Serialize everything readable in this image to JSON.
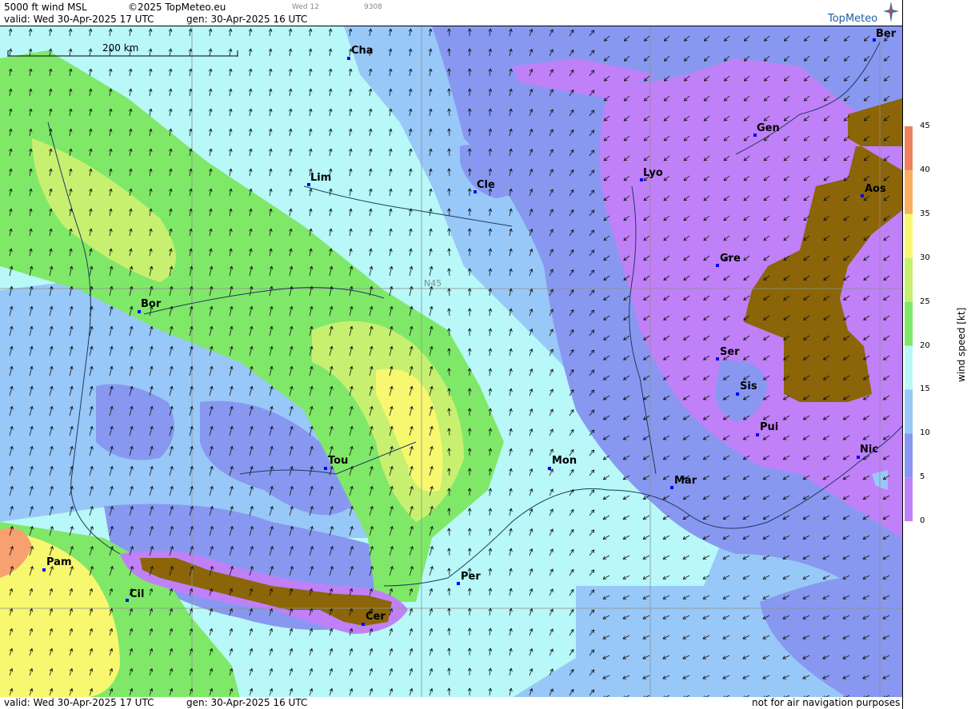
{
  "header": {
    "product": "5000 ft wind MSL",
    "copyright": "©2025 TopMeteo.eu",
    "day_code": "Wed 12",
    "code": "9308",
    "valid": "valid:  Wed  30-Apr-2025  17 UTC",
    "gen": "gen:  30-Apr-2025  16 UTC"
  },
  "logo": {
    "text": "TopMeteo"
  },
  "footer": {
    "valid": "valid:  Wed  30-Apr-2025  17 UTC",
    "gen": "gen:  30-Apr-2025  16 UTC",
    "disclaimer": "not for air navigation purposes"
  },
  "map": {
    "scale_label": "200 km",
    "grid_label": "N45",
    "cities": [
      {
        "id": "cha",
        "label": "Cha"
      },
      {
        "id": "ber",
        "label": "Ber"
      },
      {
        "id": "gen",
        "label": "Gen"
      },
      {
        "id": "lim",
        "label": "Lim"
      },
      {
        "id": "cle",
        "label": "Cle"
      },
      {
        "id": "lyo",
        "label": "Lyo"
      },
      {
        "id": "aos",
        "label": "Aos"
      },
      {
        "id": "gre",
        "label": "Gre"
      },
      {
        "id": "bor",
        "label": "Bor"
      },
      {
        "id": "ser",
        "label": "Ser"
      },
      {
        "id": "sis",
        "label": "Sis"
      },
      {
        "id": "pui",
        "label": "Pui"
      },
      {
        "id": "tou",
        "label": "Tou"
      },
      {
        "id": "mon",
        "label": "Mon"
      },
      {
        "id": "mar",
        "label": "Mar"
      },
      {
        "id": "nic",
        "label": "Nic"
      },
      {
        "id": "pam",
        "label": "Pam"
      },
      {
        "id": "cil",
        "label": "Cil"
      },
      {
        "id": "per",
        "label": "Per"
      },
      {
        "id": "cer",
        "label": "Cer"
      }
    ]
  },
  "legend": {
    "title": "wind  speed  [kt]",
    "ticks": [
      "45",
      "40",
      "35",
      "30",
      "25",
      "20",
      "15",
      "10",
      "5",
      "0"
    ],
    "colors": [
      "#f08060",
      "#f8b060",
      "#f8f870",
      "#c8f070",
      "#80e868",
      "#b8f8f8",
      "#98c8f8",
      "#8898f0",
      "#c080f8"
    ]
  },
  "colors": {
    "magenta": "#c080f8",
    "violet": "#8898f0",
    "lightblue": "#98c8f8",
    "cyan": "#b8f8f8",
    "green": "#80e868",
    "lightgreen": "#c8f070",
    "yellow": "#f8f870",
    "orange": "#f8a070",
    "terrain": "#8b6508",
    "city": "#0000ff"
  }
}
